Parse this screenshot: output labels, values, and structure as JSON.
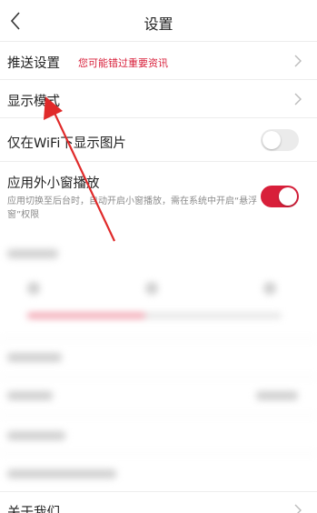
{
  "header": {
    "title": "设置",
    "back_icon": "chevron-left-icon"
  },
  "settings": {
    "push": {
      "label": "推送设置",
      "hint": "您可能错过重要资讯",
      "chevron_icon": "chevron-right-icon"
    },
    "display_mode": {
      "label": "显示模式",
      "chevron_icon": "chevron-right-icon"
    },
    "wifi_images": {
      "label": "仅在WiFi下显示图片",
      "enabled": false
    },
    "mini_window": {
      "label": "应用外小窗播放",
      "description": "应用切换至后台时，自动开启小窗播放，需在系统中开启“悬浮窗”权限",
      "enabled": true
    },
    "about": {
      "label": "关于我们"
    }
  },
  "colors": {
    "accent": "#d81f3a",
    "hint": "#d8203b",
    "annotation_arrow": "#e02a2a"
  }
}
